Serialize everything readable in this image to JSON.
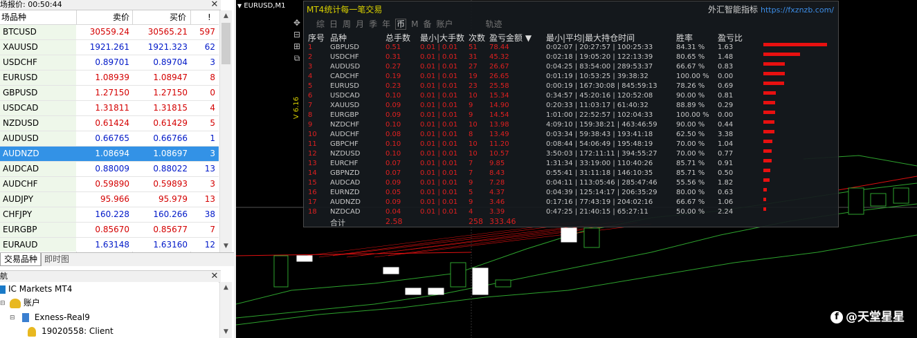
{
  "market_watch": {
    "title": "场报价: 00:50:44",
    "headers": {
      "symbol": "场品种",
      "bid": "卖价",
      "ask": "买价",
      "spread": "!"
    },
    "rows": [
      {
        "symbol": "BTCUSD",
        "bid": "30559.24",
        "ask": "30565.21",
        "spread": "597",
        "color": "red"
      },
      {
        "symbol": "XAUUSD",
        "bid": "1921.261",
        "ask": "1921.323",
        "spread": "62",
        "color": "blue"
      },
      {
        "symbol": "USDCHF",
        "bid": "0.89701",
        "ask": "0.89704",
        "spread": "3",
        "color": "blue"
      },
      {
        "symbol": "EURUSD",
        "bid": "1.08939",
        "ask": "1.08947",
        "spread": "8",
        "color": "red"
      },
      {
        "symbol": "GBPUSD",
        "bid": "1.27150",
        "ask": "1.27150",
        "spread": "0",
        "color": "red"
      },
      {
        "symbol": "USDCAD",
        "bid": "1.31811",
        "ask": "1.31815",
        "spread": "4",
        "color": "red"
      },
      {
        "symbol": "NZDUSD",
        "bid": "0.61424",
        "ask": "0.61429",
        "spread": "5",
        "color": "red"
      },
      {
        "symbol": "AUDUSD",
        "bid": "0.66765",
        "ask": "0.66766",
        "spread": "1",
        "color": "blue"
      },
      {
        "symbol": "AUDNZD",
        "bid": "1.08694",
        "ask": "1.08697",
        "spread": "3",
        "color": "blue",
        "selected": true
      },
      {
        "symbol": "AUDCAD",
        "bid": "0.88009",
        "ask": "0.88022",
        "spread": "13",
        "color": "blue"
      },
      {
        "symbol": "AUDCHF",
        "bid": "0.59890",
        "ask": "0.59893",
        "spread": "3",
        "color": "red"
      },
      {
        "symbol": "AUDJPY",
        "bid": "95.966",
        "ask": "95.979",
        "spread": "13",
        "color": "red"
      },
      {
        "symbol": "CHFJPY",
        "bid": "160.228",
        "ask": "160.266",
        "spread": "38",
        "color": "blue"
      },
      {
        "symbol": "EURGBP",
        "bid": "0.85670",
        "ask": "0.85677",
        "spread": "7",
        "color": "red"
      },
      {
        "symbol": "EURAUD",
        "bid": "1.63148",
        "ask": "1.63160",
        "spread": "12",
        "color": "blue"
      },
      {
        "symbol": "USDJPY",
        "bid": "143.720",
        "ask": "143.758",
        "spread": "38",
        "color": "blue"
      }
    ],
    "tabs": [
      "交易品种",
      "即时图"
    ]
  },
  "navigator": {
    "title": "航",
    "items": [
      "IC Markets MT4",
      "账户",
      "Exness-Real9",
      "19020558: Client"
    ]
  },
  "chart": {
    "title": "EURUSD,M1",
    "version": "V 6.16",
    "watermark": "@天堂星星"
  },
  "panel": {
    "title": "MT4统计每一笔交易",
    "brand": "外汇智能指标",
    "url": "https://fxznzb.com/",
    "periods": [
      "综",
      "日",
      "周",
      "月",
      "季",
      "年",
      "币",
      "M",
      "备",
      "账户"
    ],
    "active_period": "币",
    "track_label": "轨迹",
    "headers": [
      "序号",
      "品种",
      "总手数",
      "最小|大手数",
      "次数",
      "盈亏金额 ▼",
      "最小|平均|最大持仓时间",
      "胜率",
      "盈亏比"
    ],
    "rows": [
      {
        "n": "1",
        "sym": "GBPUSD",
        "lots": "0.51",
        "mm": "0.01 | 0.01",
        "cnt": "51",
        "pnl": "78.44",
        "hold": "0:02:07 | 20:27:57 | 100:25:33",
        "win": "84.31 %",
        "ratio": "1.63",
        "bar": 78.44
      },
      {
        "n": "2",
        "sym": "USDCHF",
        "lots": "0.31",
        "mm": "0.01 | 0.01",
        "cnt": "31",
        "pnl": "45.32",
        "hold": "0:02:18 | 19:05:20 | 122:13:39",
        "win": "80.65 %",
        "ratio": "1.48",
        "bar": 45.32
      },
      {
        "n": "3",
        "sym": "AUDUSD",
        "lots": "0.27",
        "mm": "0.01 | 0.01",
        "cnt": "27",
        "pnl": "26.67",
        "hold": "0:04:25 | 83:54:00 | 289:53:37",
        "win": "66.67 %",
        "ratio": "0.83",
        "bar": 26.67
      },
      {
        "n": "4",
        "sym": "CADCHF",
        "lots": "0.19",
        "mm": "0.01 | 0.01",
        "cnt": "19",
        "pnl": "26.65",
        "hold": "0:01:19 | 10:53:25 | 39:38:32",
        "win": "100.00 %",
        "ratio": "0.00",
        "bar": 26.65
      },
      {
        "n": "5",
        "sym": "EURUSD",
        "lots": "0.23",
        "mm": "0.01 | 0.01",
        "cnt": "23",
        "pnl": "25.58",
        "hold": "0:00:19 | 167:30:08 | 845:59:13",
        "win": "78.26 %",
        "ratio": "0.69",
        "bar": 25.58
      },
      {
        "n": "6",
        "sym": "USDCAD",
        "lots": "0.10",
        "mm": "0.01 | 0.01",
        "cnt": "10",
        "pnl": "15.34",
        "hold": "0:34:57 | 45:20:16 | 120:52:08",
        "win": "90.00 %",
        "ratio": "0.81",
        "bar": 15.34
      },
      {
        "n": "7",
        "sym": "XAUUSD",
        "lots": "0.09",
        "mm": "0.01 | 0.01",
        "cnt": "9",
        "pnl": "14.90",
        "hold": "0:20:33 | 11:03:17 | 61:40:32",
        "win": "88.89 %",
        "ratio": "0.29",
        "bar": 14.9
      },
      {
        "n": "8",
        "sym": "EURGBP",
        "lots": "0.09",
        "mm": "0.01 | 0.01",
        "cnt": "9",
        "pnl": "14.54",
        "hold": "1:01:00 | 22:52:57 | 102:04:33",
        "win": "100.00 %",
        "ratio": "0.00",
        "bar": 14.54
      },
      {
        "n": "9",
        "sym": "NZDCHF",
        "lots": "0.10",
        "mm": "0.01 | 0.01",
        "cnt": "10",
        "pnl": "13.98",
        "hold": "4:09:10 | 159:38:21 | 463:46:59",
        "win": "90.00 %",
        "ratio": "0.44",
        "bar": 13.98
      },
      {
        "n": "10",
        "sym": "AUDCHF",
        "lots": "0.08",
        "mm": "0.01 | 0.01",
        "cnt": "8",
        "pnl": "13.49",
        "hold": "0:03:34 | 59:38:43 | 193:41:18",
        "win": "62.50 %",
        "ratio": "3.38",
        "bar": 13.49
      },
      {
        "n": "11",
        "sym": "GBPCHF",
        "lots": "0.10",
        "mm": "0.01 | 0.01",
        "cnt": "10",
        "pnl": "11.20",
        "hold": "0:08:44 | 54:06:49 | 195:48:19",
        "win": "70.00 %",
        "ratio": "1.04",
        "bar": 11.2
      },
      {
        "n": "12",
        "sym": "NZDUSD",
        "lots": "0.10",
        "mm": "0.01 | 0.01",
        "cnt": "10",
        "pnl": "10.57",
        "hold": "3:50:03 | 172:11:11 | 394:55:27",
        "win": "70.00 %",
        "ratio": "0.77",
        "bar": 10.57
      },
      {
        "n": "13",
        "sym": "EURCHF",
        "lots": "0.07",
        "mm": "0.01 | 0.01",
        "cnt": "7",
        "pnl": "9.85",
        "hold": "1:31:34 | 33:19:00 | 110:40:26",
        "win": "85.71 %",
        "ratio": "0.91",
        "bar": 9.85
      },
      {
        "n": "14",
        "sym": "GBPNZD",
        "lots": "0.07",
        "mm": "0.01 | 0.01",
        "cnt": "7",
        "pnl": "8.43",
        "hold": "0:55:41 | 31:11:18 | 146:10:35",
        "win": "85.71 %",
        "ratio": "0.50",
        "bar": 8.43
      },
      {
        "n": "15",
        "sym": "AUDCAD",
        "lots": "0.09",
        "mm": "0.01 | 0.01",
        "cnt": "9",
        "pnl": "7.28",
        "hold": "0:04:11 | 113:05:46 | 285:47:46",
        "win": "55.56 %",
        "ratio": "1.82",
        "bar": 7.28
      },
      {
        "n": "16",
        "sym": "EURNZD",
        "lots": "0.05",
        "mm": "0.01 | 0.01",
        "cnt": "5",
        "pnl": "4.37",
        "hold": "0:04:39 | 125:14:17 | 206:35:29",
        "win": "80.00 %",
        "ratio": "0.63",
        "bar": 4.37
      },
      {
        "n": "17",
        "sym": "AUDNZD",
        "lots": "0.09",
        "mm": "0.01 | 0.01",
        "cnt": "9",
        "pnl": "3.46",
        "hold": "0:17:16 | 77:43:19 | 204:02:16",
        "win": "66.67 %",
        "ratio": "1.06",
        "bar": 3.46
      },
      {
        "n": "18",
        "sym": "NZDCAD",
        "lots": "0.04",
        "mm": "0.01 | 0.01",
        "cnt": "4",
        "pnl": "3.39",
        "hold": "0:47:25 | 21:40:15 | 65:27:11",
        "win": "50.00 %",
        "ratio": "2.24",
        "bar": 3.39
      }
    ],
    "total": {
      "label": "合计",
      "lots": "2.58",
      "cnt": "258",
      "pnl": "333.46"
    }
  },
  "colors": {
    "bid_red": "#d40000",
    "bid_blue": "#0018c8",
    "selected": "#3392e6",
    "profit_red": "#e02020",
    "bar_red": "#e81010"
  }
}
